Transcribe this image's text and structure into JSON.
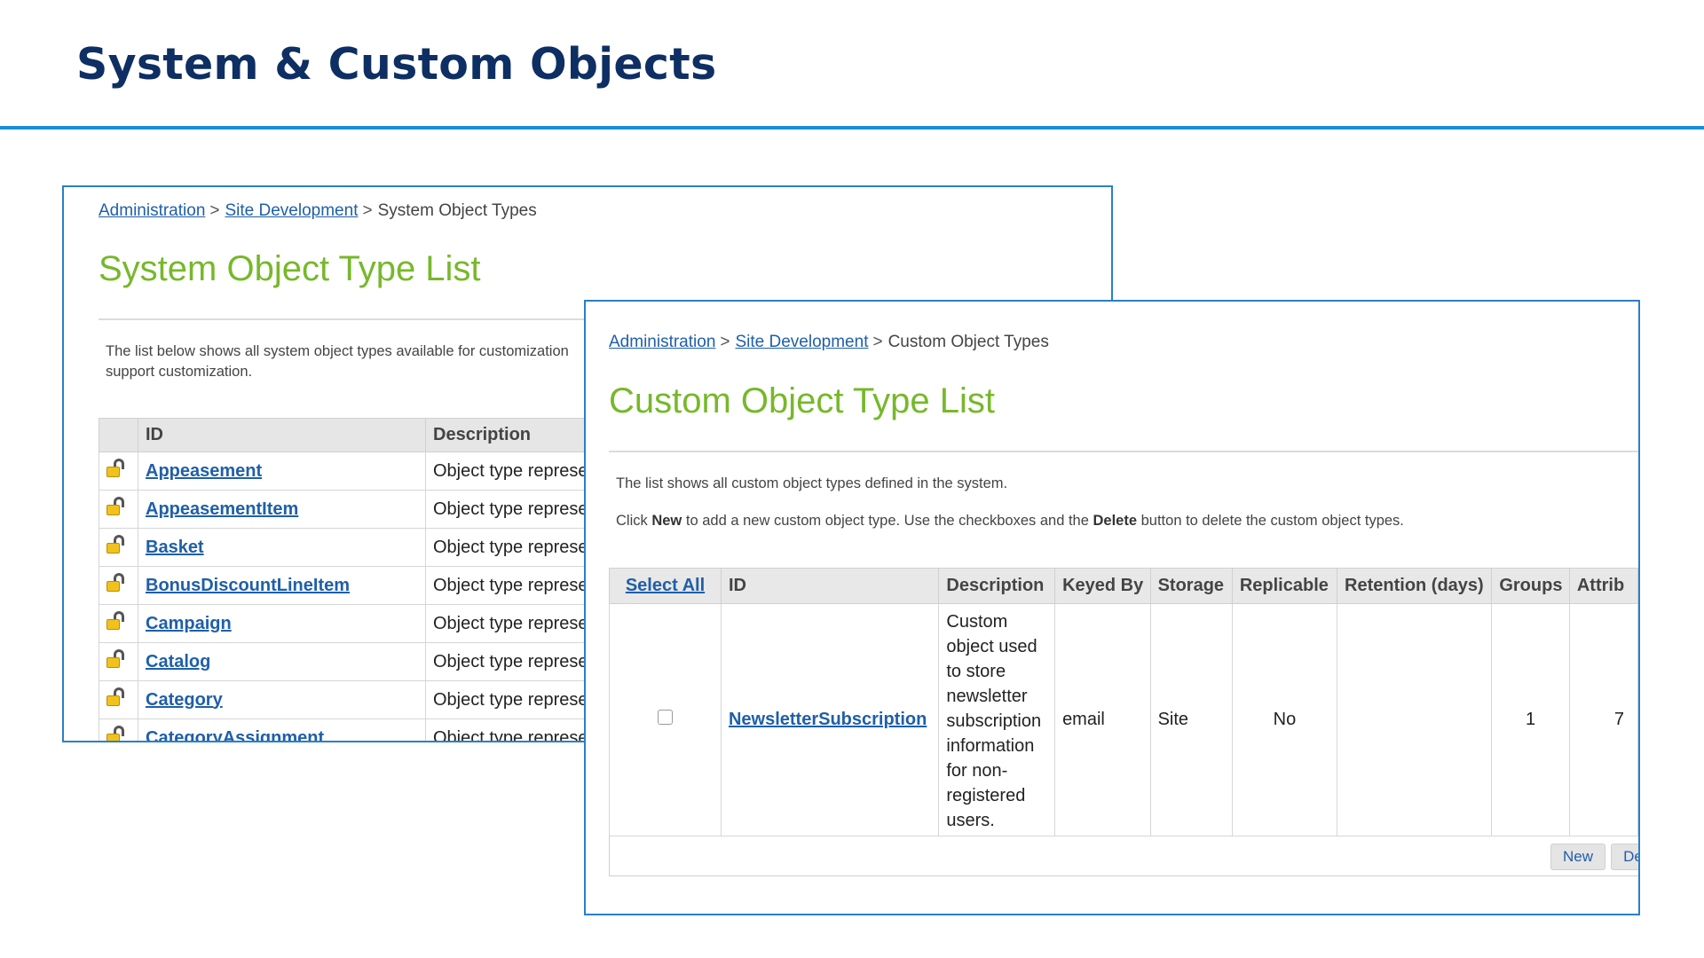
{
  "slide": {
    "title": "System & Custom Objects"
  },
  "system_panel": {
    "breadcrumb": {
      "admin": "Administration",
      "site_dev": "Site Development",
      "current": "System Object Types",
      "separator": ">"
    },
    "heading": "System Object Type List",
    "info_line1": "The list below shows all system object types available for customization",
    "info_line2": "support customization.",
    "table": {
      "col_id": "ID",
      "col_description": "Description",
      "rows": [
        {
          "id": "Appeasement",
          "description": "Object type represe"
        },
        {
          "id": "AppeasementItem",
          "description": "Object type represe"
        },
        {
          "id": "Basket",
          "description": "Object type represe"
        },
        {
          "id": "BonusDiscountLineItem",
          "description": "Object type represe"
        },
        {
          "id": "Campaign",
          "description": "Object type represe"
        },
        {
          "id": "Catalog",
          "description": "Object type represe"
        },
        {
          "id": "Category",
          "description": "Object type represe"
        },
        {
          "id": "CategoryAssignment",
          "description": "Object type represe"
        }
      ]
    }
  },
  "custom_panel": {
    "breadcrumb": {
      "admin": "Administration",
      "site_dev": "Site Development",
      "current": "Custom Object Types",
      "separator": ">"
    },
    "heading": "Custom Object Type List",
    "info_line1": "The list shows all custom object types defined in the system.",
    "info_line2": {
      "click": "Click",
      "new": "New",
      "mid": "to add a new custom object type. Use the checkboxes and the",
      "delete": "Delete",
      "end": "button to delete the custom object types."
    },
    "table": {
      "headers": {
        "select_all": "Select All",
        "id": "ID",
        "description": "Description",
        "keyed_by": "Keyed By",
        "storage": "Storage",
        "replicable": "Replicable",
        "retention": "Retention (days)",
        "groups": "Groups",
        "attributes": "Attrib"
      },
      "row": {
        "id": "NewsletterSubscription",
        "description_lines": [
          "Custom",
          "object used",
          "to store",
          "newsletter",
          "subscription",
          "information",
          "for non-",
          "registered",
          "users."
        ],
        "keyed_by": "email",
        "storage": "Site",
        "replicable": "No",
        "retention": "",
        "groups": "1",
        "attributes": "7"
      }
    },
    "buttons": {
      "new": "New",
      "delete": "De"
    }
  }
}
